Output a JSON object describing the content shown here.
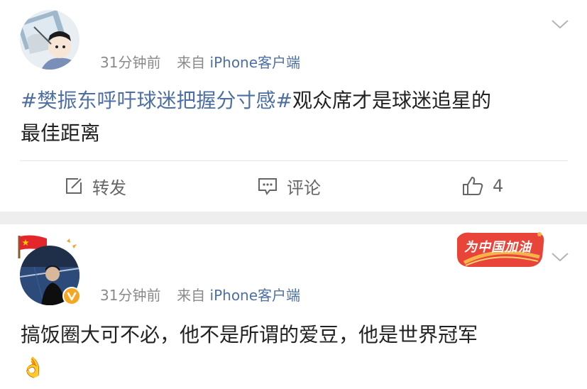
{
  "post1": {
    "timestamp": "31分钟前",
    "source_prefix": "来自",
    "source": "iPhone客户端",
    "hashtag": "#樊振东呼吁球迷把握分寸感#",
    "text_line1": "观众席才是球迷追星的",
    "text_line2": "最佳距离",
    "actions": {
      "repost_label": "转发",
      "comment_label": "评论",
      "like_count": "4"
    }
  },
  "post2": {
    "timestamp": "31分钟前",
    "source_prefix": "来自",
    "source": "iPhone客户端",
    "badge_text": "为中国加油",
    "text": "搞饭圈大可不必，他不是所谓的爱豆，他是世界冠军",
    "emoji": "👌"
  },
  "colors": {
    "link": "#4e6fa3",
    "text": "#222222",
    "meta": "#8a8a8a",
    "separator": "#eeeeee",
    "verified": "#f5a623",
    "badge": "#e8443a"
  },
  "icons": [
    "chevron-down-icon",
    "edit-icon",
    "comment-icon",
    "thumbs-up-icon",
    "verified-icon",
    "china-flag-icon"
  ]
}
